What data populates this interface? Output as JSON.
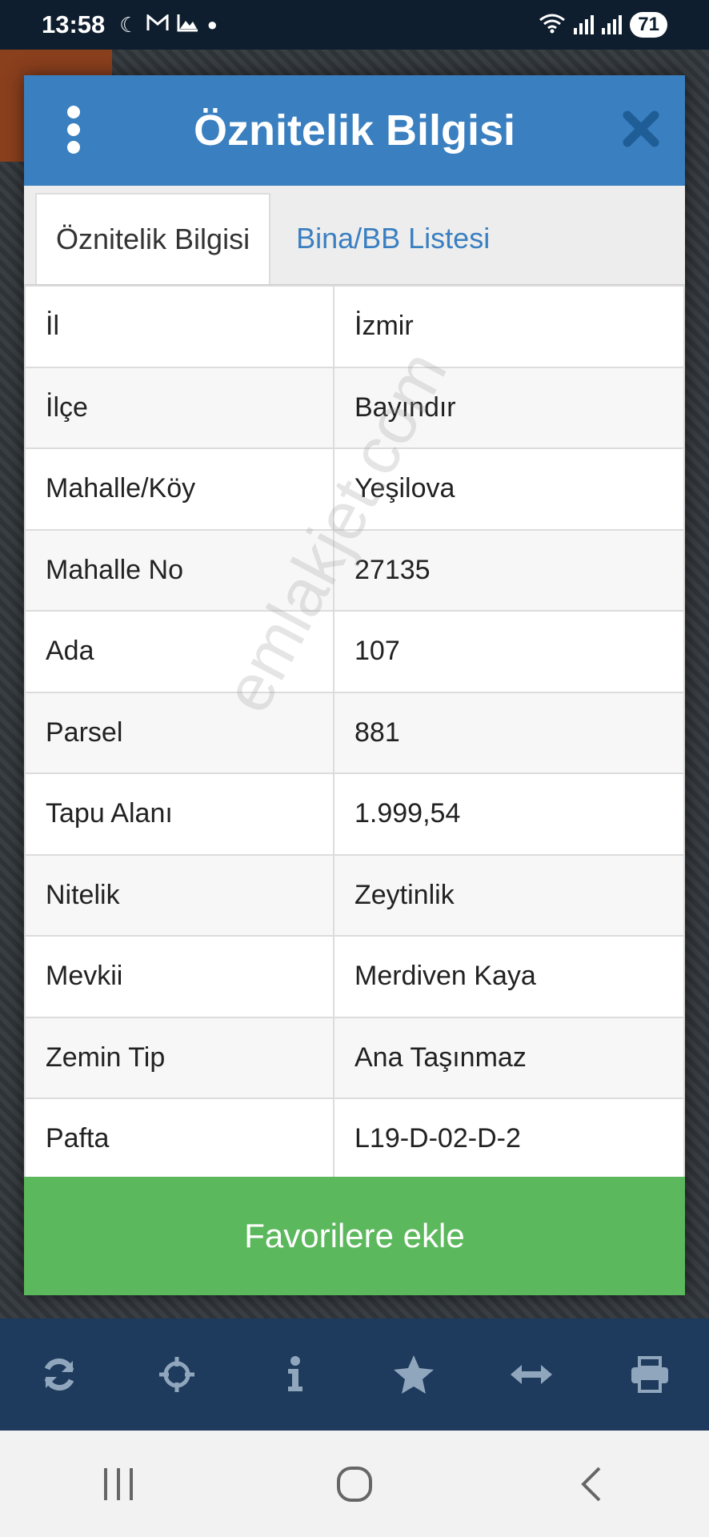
{
  "status_bar": {
    "time": "13:58",
    "battery": "71"
  },
  "modal": {
    "title": "Öznitelik Bilgisi",
    "tabs": [
      {
        "label": "Öznitelik Bilgisi",
        "active": true
      },
      {
        "label": "Bina/BB Listesi",
        "active": false
      }
    ],
    "rows": [
      {
        "key": "İl",
        "value": "İzmir"
      },
      {
        "key": "İlçe",
        "value": "Bayındır"
      },
      {
        "key": "Mahalle/Köy",
        "value": "Yeşilova"
      },
      {
        "key": "Mahalle No",
        "value": "27135"
      },
      {
        "key": "Ada",
        "value": "107"
      },
      {
        "key": "Parsel",
        "value": "881"
      },
      {
        "key": "Tapu Alanı",
        "value": "1.999,54"
      },
      {
        "key": "Nitelik",
        "value": "Zeytinlik"
      },
      {
        "key": "Mevkii",
        "value": "Merdiven Kaya"
      },
      {
        "key": "Zemin Tip",
        "value": "Ana Taşınmaz"
      },
      {
        "key": "Pafta",
        "value": "L19-D-02-D-2"
      }
    ],
    "favorite_button": "Favorilere ekle"
  },
  "watermark": "emlakjet.com",
  "toolbar": {
    "icons": [
      "refresh-icon",
      "crosshair-icon",
      "info-icon",
      "star-icon",
      "horizontal-arrows-icon",
      "printer-icon"
    ]
  },
  "colors": {
    "header": "#3a7fc0",
    "favorite": "#5cb85c",
    "toolbar": "#1e3a5c",
    "toolbar_icon": "#8fa6bd"
  }
}
